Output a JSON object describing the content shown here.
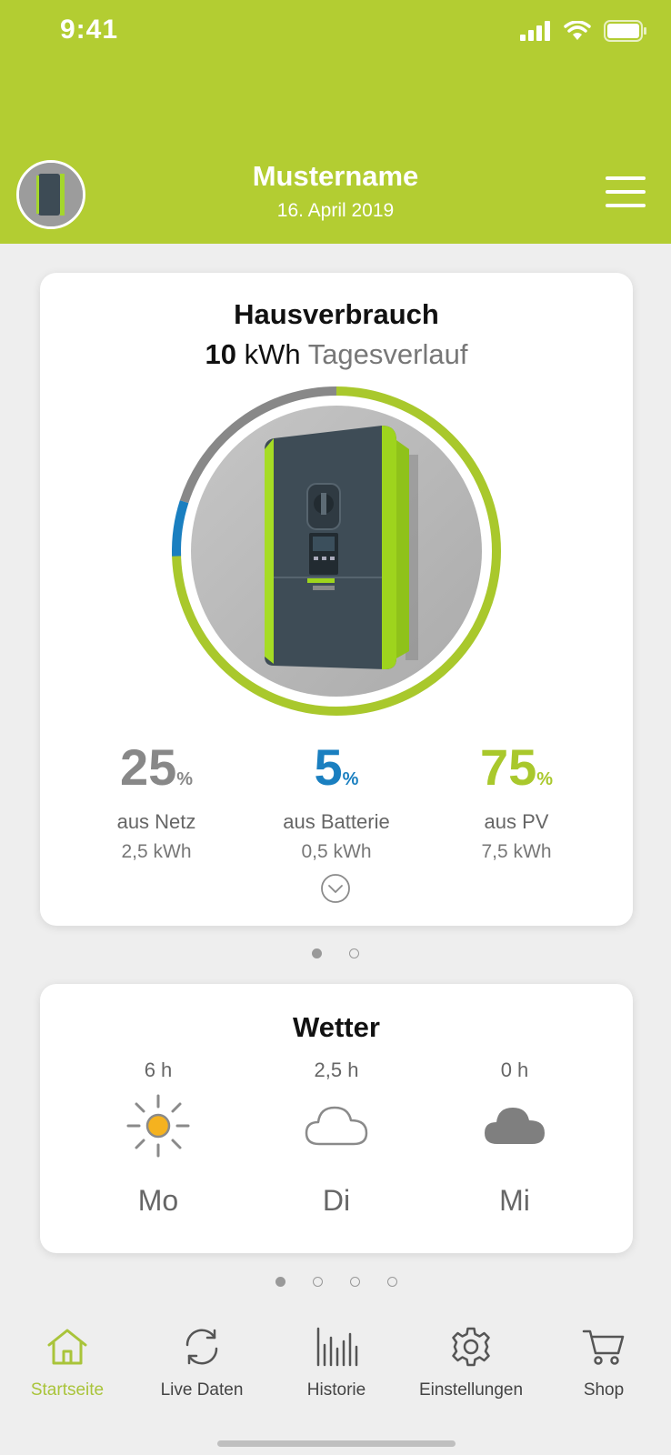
{
  "status_bar": {
    "time": "9:41",
    "icons": [
      "signal-icon",
      "wifi-icon",
      "battery-icon"
    ]
  },
  "header": {
    "name": "Mustername",
    "date": "16. April 2019",
    "menu_icon": "hamburger-menu-icon"
  },
  "colors": {
    "brand_green": "#b3cd32",
    "grid_gray": "#888888",
    "battery_blue": "#1a7fc0",
    "pv_green": "#a9c82c"
  },
  "consumption_card": {
    "title": "Hausverbrauch",
    "value": "10",
    "unit": "kWh",
    "subtitle_suffix": "Tagesverlauf",
    "ring_fractions": {
      "netz": 0.25,
      "batterie": 0.05,
      "pv": 0.75
    },
    "stats": [
      {
        "percent": "25",
        "pct_sign": "%",
        "label": "aus Netz",
        "energy": "2,5 kWh",
        "color": "#888888"
      },
      {
        "percent": "5",
        "pct_sign": "%",
        "label": "aus Batterie",
        "energy": "0,5 kWh",
        "color": "#1a7fc0"
      },
      {
        "percent": "75",
        "pct_sign": "%",
        "label": "aus PV",
        "energy": "7,5 kWh",
        "color": "#a9c82c"
      }
    ],
    "expand_icon": "chevron-down-circle-icon",
    "pager": {
      "count": 2,
      "active": 0
    }
  },
  "weather_card": {
    "title": "Wetter",
    "days": [
      {
        "hours": "6 h",
        "icon": "sun-icon",
        "day": "Mo"
      },
      {
        "hours": "2,5 h",
        "icon": "cloud-outline-icon",
        "day": "Di"
      },
      {
        "hours": "0 h",
        "icon": "cloud-filled-icon",
        "day": "Mi"
      }
    ],
    "pager": {
      "count": 4,
      "active": 0
    }
  },
  "nav": [
    {
      "label": "Startseite",
      "icon": "home-icon",
      "active": true
    },
    {
      "label": "Live Daten",
      "icon": "refresh-icon",
      "active": false
    },
    {
      "label": "Historie",
      "icon": "bar-chart-icon",
      "active": false
    },
    {
      "label": "Einstellungen",
      "icon": "gear-icon",
      "active": false
    },
    {
      "label": "Shop",
      "icon": "cart-icon",
      "active": false
    }
  ]
}
